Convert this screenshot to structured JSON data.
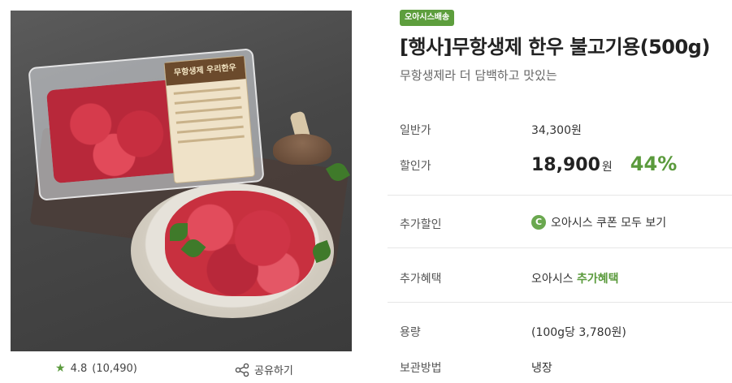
{
  "product_image": {
    "label_text": "무항생제 우리한우"
  },
  "rating": {
    "icon": "star-icon",
    "score": "4.8",
    "count": "(10,490)"
  },
  "share": {
    "icon": "share-icon",
    "label": "공유하기"
  },
  "badge": "오아시스배송",
  "title": "[행사]무항생제 한우 불고기용(500g)",
  "subtitle": "무항생제라 더 담백하고 맛있는",
  "info": {
    "regular_price": {
      "label": "일반가",
      "value": "34,300원"
    },
    "sale_price": {
      "label": "할인가",
      "value": "18,900",
      "unit": "원",
      "discount": "44%"
    },
    "extra_discount": {
      "label": "추가할인",
      "coupon_icon_text": "C",
      "value": "오아시스 쿠폰 모두 보기"
    },
    "extra_benefit": {
      "label": "추가혜택",
      "prefix": "오아시스 ",
      "link": "추가혜택"
    },
    "capacity": {
      "label": "용량",
      "value": "(100g당 3,780원)"
    },
    "storage": {
      "label": "보관방법",
      "value": "냉장"
    }
  },
  "colors": {
    "accent_green": "#5a9a3c",
    "badge_green": "#5d9e3d"
  }
}
